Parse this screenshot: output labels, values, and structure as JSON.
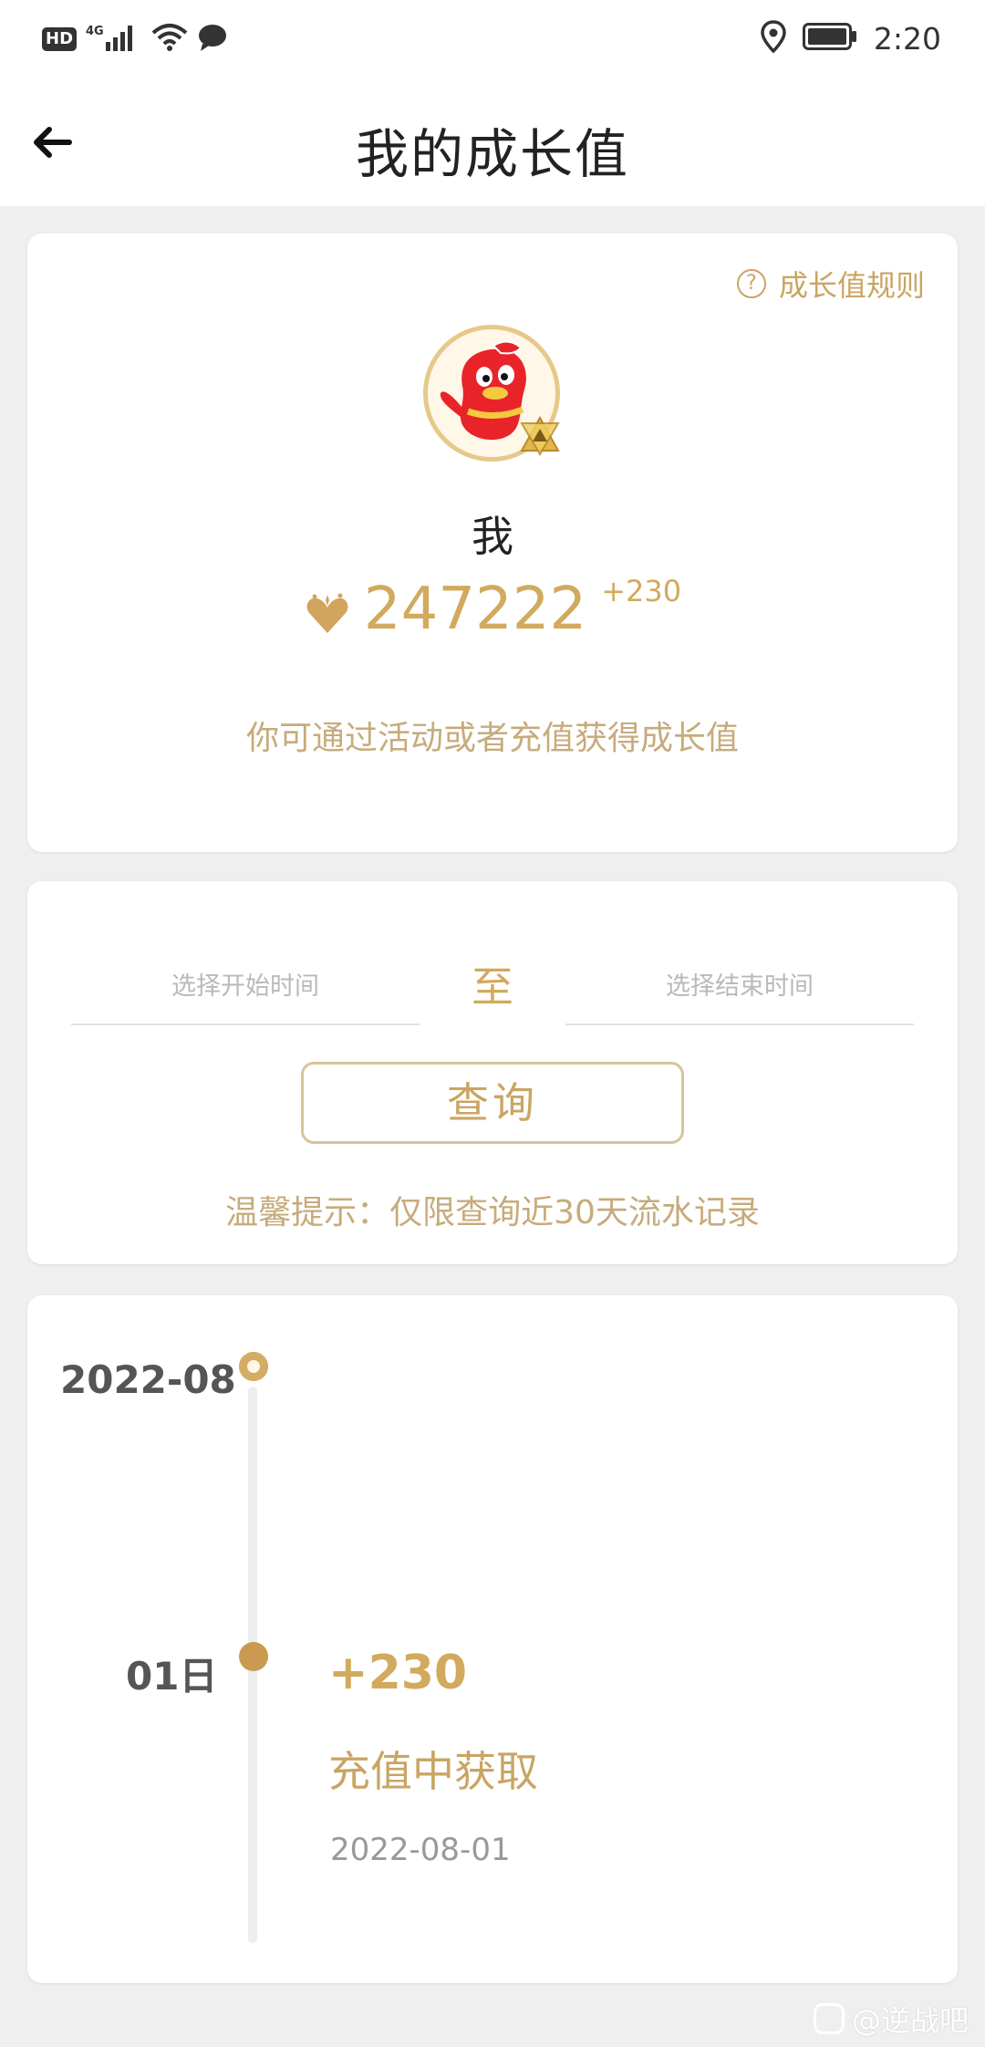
{
  "status_bar": {
    "network_badge": "HD",
    "network_type": "4G",
    "time": "2:20"
  },
  "header": {
    "title": "我的成长值"
  },
  "profile": {
    "rules_link": "成长值规则",
    "rules_icon_text": "?",
    "username": "我",
    "growth_value": "247222",
    "growth_delta": "+230",
    "hint": "你可通过活动或者充值获得成长值"
  },
  "query": {
    "start_placeholder": "选择开始时间",
    "to_label": "至",
    "end_placeholder": "选择结束时间",
    "button_label": "查询",
    "tip": "温馨提示：仅限查询近30天流水记录"
  },
  "timeline": {
    "month": "2022-08",
    "records": [
      {
        "day": "01日",
        "amount": "+230",
        "source": "充值中获取",
        "date": "2022-08-01"
      }
    ]
  },
  "watermark": {
    "text": "@逆战吧"
  },
  "colors": {
    "accent_gold": "#d1aa5d",
    "avatar_red": "#e8242a"
  }
}
